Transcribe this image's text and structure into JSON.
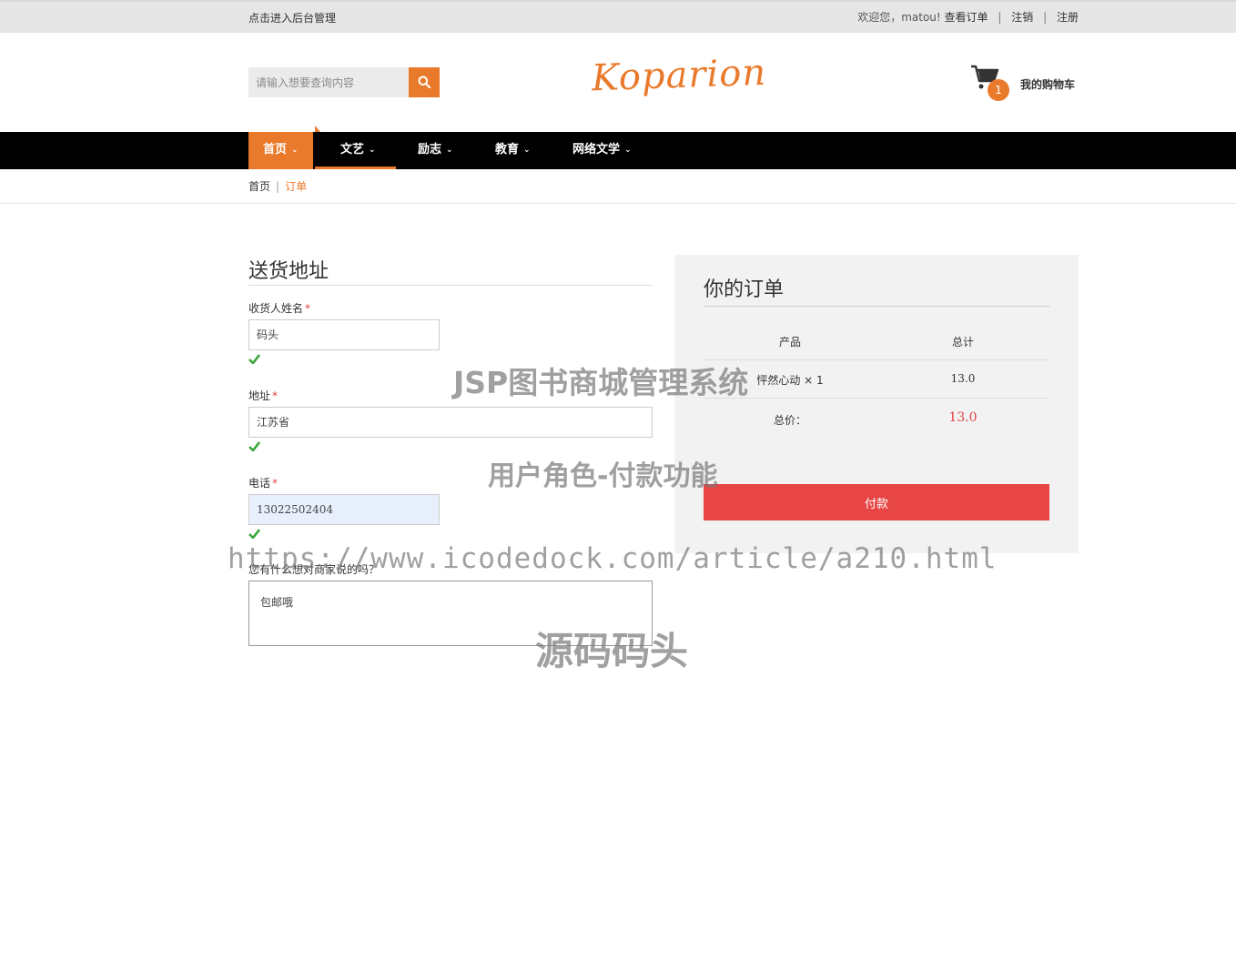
{
  "topbar": {
    "admin_link": "点击进入后台管理",
    "greeting": "欢迎您，matou!",
    "view_orders": "查看订单",
    "logout": "注销",
    "register": "注册",
    "separator": "|"
  },
  "header": {
    "search_placeholder": "请输入想要查询内容",
    "logo": "Koparion",
    "cart_count": "1",
    "cart_label": "我的购物车"
  },
  "nav": {
    "items": [
      {
        "label": "首页"
      },
      {
        "label": "文艺"
      },
      {
        "label": "励志"
      },
      {
        "label": "教育"
      },
      {
        "label": "网络文学"
      }
    ],
    "chevron": "⌄"
  },
  "breadcrumb": {
    "home": "首页",
    "separator": "|",
    "current": "订单"
  },
  "shipping": {
    "title": "送货地址",
    "name_label": "收货人姓名",
    "name_value": "码头",
    "address_label": "地址",
    "address_value": "江苏省",
    "phone_label": "电话",
    "phone_value": "13022502404",
    "required_mark": "*",
    "note_label": "您有什么想对商家说的吗？",
    "note_value": "包邮哦"
  },
  "order": {
    "title": "你的订单",
    "col_product": "产品",
    "col_total": "总计",
    "items": [
      {
        "product": "怦然心动 × 1",
        "total": "13.0"
      }
    ],
    "total_label": "总价：",
    "total_value": "13.0",
    "pay_button": "付款"
  },
  "watermarks": {
    "line1": "JSP图书商城管理系统",
    "line2": "用户角色-付款功能",
    "line3": "https://www.icodedock.com/article/a210.html",
    "line4": "源码码头"
  },
  "colors": {
    "accent": "#ea7a2b",
    "pay": "#e84545",
    "nav_bg": "#000000",
    "check": "#3aa63a"
  }
}
